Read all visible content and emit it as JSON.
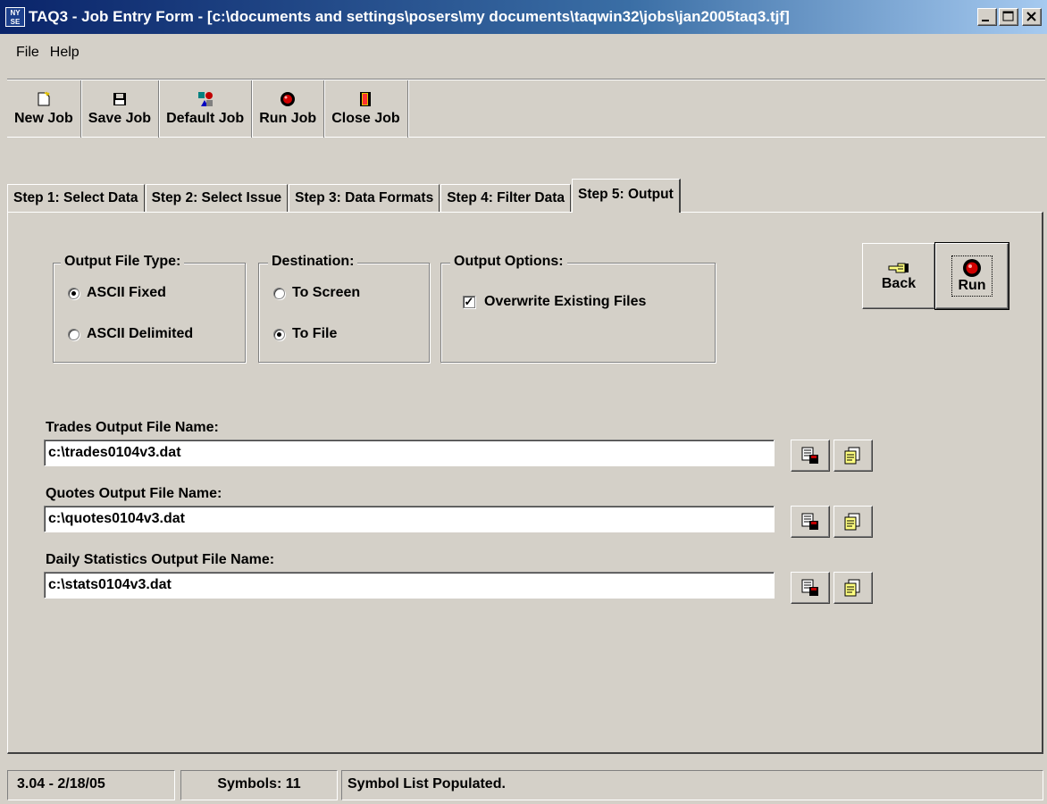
{
  "window": {
    "title": "TAQ3 - Job Entry Form - [c:\\documents and settings\\posers\\my documents\\taqwin32\\jobs\\jan2005taq3.tjf]",
    "icon_text": "NY SE",
    "buttons": [
      "minimize-icon",
      "maximize-icon",
      "close-icon"
    ]
  },
  "menu": {
    "file": "File",
    "help": "Help"
  },
  "toolbar": {
    "new_job": "New Job",
    "save_job": "Save Job",
    "default_job": "Default Job",
    "run_job": "Run Job",
    "close_job": "Close Job"
  },
  "tabs": [
    {
      "label": "Step 1: Select Data"
    },
    {
      "label": "Step 2: Select Issue"
    },
    {
      "label": "Step 3: Data Formats"
    },
    {
      "label": "Step 4: Filter Data"
    },
    {
      "label": "Step 5: Output",
      "active": true
    }
  ],
  "output_file_type": {
    "legend": "Output File Type:",
    "ascii_fixed": "ASCII Fixed",
    "ascii_delimited": "ASCII Delimited",
    "selected": "ascii_fixed"
  },
  "destination": {
    "legend": "Destination:",
    "to_screen": "To Screen",
    "to_file": "To File",
    "selected": "to_file"
  },
  "output_options": {
    "legend": "Output Options:",
    "overwrite": "Overwrite Existing Files",
    "overwrite_checked": true
  },
  "nav": {
    "back": "Back",
    "run": "Run"
  },
  "files": {
    "trades_label": "Trades Output File Name:",
    "trades_value": "c:\\trades0104v3.dat",
    "quotes_label": "Quotes Output File Name:",
    "quotes_value": "c:\\quotes0104v3.dat",
    "stats_label": "Daily Statistics Output File Name:",
    "stats_value": "c:\\stats0104v3.dat"
  },
  "status": {
    "version": "3.04 - 2/18/05",
    "symbols": "Symbols: 11",
    "message": "Symbol List Populated."
  },
  "colors": {
    "face": "#d4d0c8",
    "title_start": "#0a246a",
    "title_end": "#a6caf0",
    "run_red": "#cc0000"
  }
}
